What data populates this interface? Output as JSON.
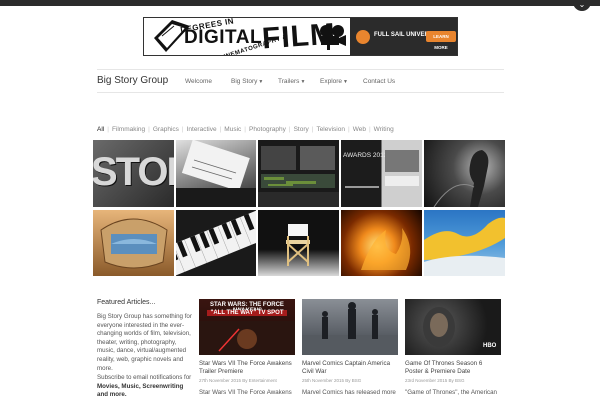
{
  "banner": {
    "degrees_in": "DEGREES IN",
    "digital": "DIGITAL",
    "cinematography": "CINEMATOGRAPHY &",
    "film": "FILM",
    "university": "FULL SAIL UNIVERSITY.",
    "cta": "LEARN MORE"
  },
  "header": {
    "brand": "Big Story Group",
    "nav": [
      {
        "label": "Welcome",
        "dropdown": false
      },
      {
        "label": "Big Story",
        "dropdown": true
      },
      {
        "label": "Trailers",
        "dropdown": true
      },
      {
        "label": "Explore",
        "dropdown": true
      },
      {
        "label": "Contact Us",
        "dropdown": false
      }
    ]
  },
  "filters": [
    "All",
    "Filmmaking",
    "Graphics",
    "Interactive",
    "Music",
    "Photography",
    "Story",
    "Television",
    "Web",
    "Writing"
  ],
  "tiles": [
    {
      "name": "story-letters",
      "overlay": "STOR"
    },
    {
      "name": "typewriter-paper",
      "overlay": ""
    },
    {
      "name": "video-editing-suite",
      "overlay": ""
    },
    {
      "name": "awards-2013",
      "overlay": "AWARDS 2013"
    },
    {
      "name": "dark-figure-silhouette",
      "overlay": ""
    },
    {
      "name": "ancient-helmet",
      "overlay": ""
    },
    {
      "name": "tv-set-vintage",
      "overlay": ""
    },
    {
      "name": "piano-keys",
      "overlay": ""
    },
    {
      "name": "directors-chair",
      "overlay": ""
    },
    {
      "name": "fire-explosion",
      "overlay": ""
    },
    {
      "name": "blue-yellow-abstract",
      "overlay": ""
    }
  ],
  "featured": {
    "heading": "Featured Articles...",
    "intro": "Big Story Group has something for everyone interested in the ever-changing worlds of film, television, theater, writing, photography, music, dance, virtual/augmented reality, web, graphic novels and more.",
    "subscribe_prefix": "Subscribe to email notifications for ",
    "subscribe_bold": "Movies, Music, Screenwriting and more."
  },
  "cards": [
    {
      "image_caption_line1": "STAR WARS: THE FORCE AWAKENS",
      "image_caption_line2": "\"ALL THE WAY\" TV SPOT",
      "title": "Star Wars VII The Force Awakens Trailer Premiere",
      "meta": "27th November 2015 By Entertainment",
      "excerpt": "Star Wars VII The Force Awakens"
    },
    {
      "image_caption_line1": "",
      "image_caption_line2": "",
      "title": "Marvel Comics Captain America Civil War",
      "meta": "25th November 2015 By BSG",
      "excerpt": "Marvel Comics has released more"
    },
    {
      "image_caption_line1": "HBO",
      "image_caption_line2": "",
      "title": "Game Of Thrones Season 6 Poster & Premiere Date",
      "meta": "23rd November 2015 By BSG",
      "excerpt": "\"Game of Thrones\", the American"
    }
  ]
}
